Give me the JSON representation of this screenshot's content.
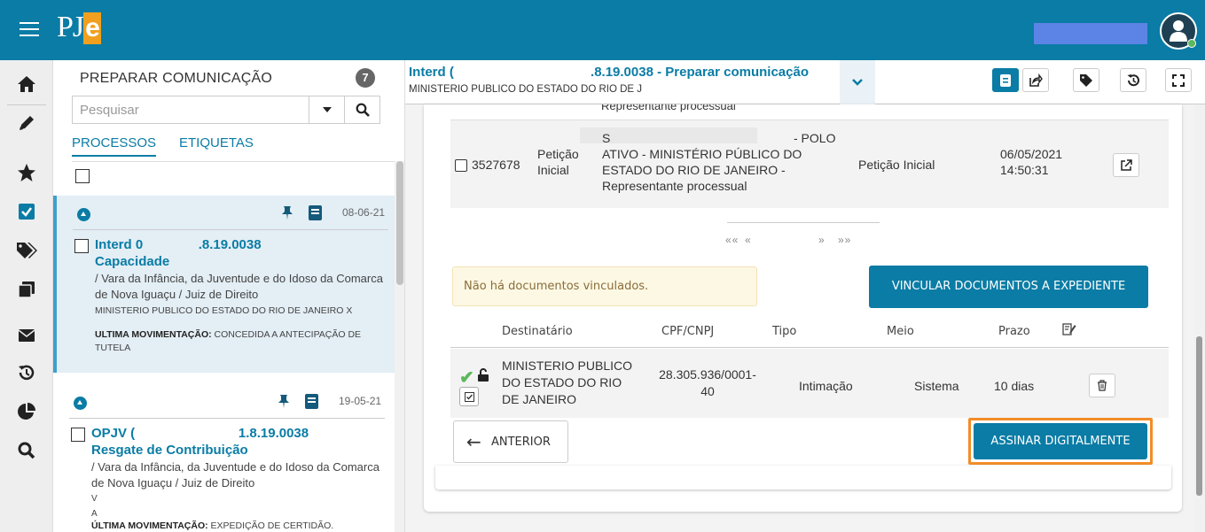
{
  "app": {
    "logo_text": "PJ",
    "logo_accent": "e",
    "brand_color": "#0a7ca5",
    "accent_color": "#f0a01e"
  },
  "rail_icons": [
    "home-icon",
    "pencil-icon",
    "star-icon",
    "checkbox-icon",
    "tags-icon",
    "copy-icon",
    "envelope-icon",
    "history-icon",
    "pie-chart-icon",
    "search-icon"
  ],
  "process_list": {
    "title": "PREPARAR COMUNICAÇÃO",
    "count": "7",
    "search_placeholder": "Pesquisar",
    "tabs": [
      {
        "label": "PROCESSOS",
        "active": true
      },
      {
        "label": "ETIQUETAS",
        "active": false
      }
    ],
    "items": [
      {
        "date": "08-06-21",
        "number": "Interd 0               .8.19.0038",
        "subject": "Capacidade",
        "court": "/ Vara da Infância, da Juventude e do Idoso da Comarca de Nova Iguaçu / Juiz de Direito",
        "parties": "MINISTERIO PUBLICO DO ESTADO DO RIO DE JANEIRO X",
        "last_mov_label": "ULTIMA MOVIMENTAÇÃO:",
        "last_mov_value": "CONCEDIDA A ANTECIPAÇÃO DE TUTELA"
      },
      {
        "date": "19-05-21",
        "number": "OPJV (                            1.8.19.0038",
        "subject": "Resgate de Contribuição",
        "court": "/ Vara da Infância, da Juventude e do Idoso da Comarca de Nova Iguaçu / Juiz de Direito",
        "parties_a": "V",
        "parties_b": "A",
        "last_mov_label": "ÚLTIMA MOVIMENTAÇÃO:",
        "last_mov_value": "EXPEDIÇÃO DE CERTIDÃO."
      }
    ]
  },
  "header": {
    "title": "Interd (                                     .8.19.0038 - Preparar comunicação",
    "subtitle": "MINISTERIO PUBLICO DO ESTADO DO RIO DE J"
  },
  "documents": {
    "prev_row_text": "Representante processual",
    "row": {
      "id": "3527678",
      "type": "Petição Inicial",
      "name_prefix": "S",
      "name": "- POLO ATIVO - MINISTÉRIO PÚBLICO DO ESTADO DO RIO DE JANEIRO - Representante processual",
      "name_line1": "- POLO",
      "name_line2": "ATIVO - MINISTÉRIO PÚBLICO DO",
      "name_line3": "ESTADO DO RIO DE JANEIRO -",
      "name_line4": "Representante processual",
      "doc_type": "Petição Inicial",
      "date": "06/05/2021",
      "time": "14:50:31"
    },
    "pager": {
      "first": "««",
      "prev": "«",
      "next": "»",
      "last": "»»"
    }
  },
  "alert_text": "Não há documentos vinculados.",
  "vincular_label": "VINCULAR DOCUMENTOS A EXPEDIENTE",
  "recipients": {
    "headers": [
      "Destinatário",
      "CPF/CNPJ",
      "Tipo",
      "Meio",
      "Prazo"
    ],
    "row": {
      "dest_line1": "MINISTERIO PUBLICO",
      "dest_line2": "DO ESTADO DO RIO",
      "dest_line3": "DE JANEIRO",
      "cpf_line1": "28.305.936/0001-",
      "cpf_line2": "40",
      "tipo": "Intimação",
      "meio": "Sistema",
      "prazo": "10 dias"
    }
  },
  "anterior_label": "ANTERIOR",
  "assinar_label": "ASSINAR DIGITALMENTE",
  "highlight_color": "#f28c28"
}
